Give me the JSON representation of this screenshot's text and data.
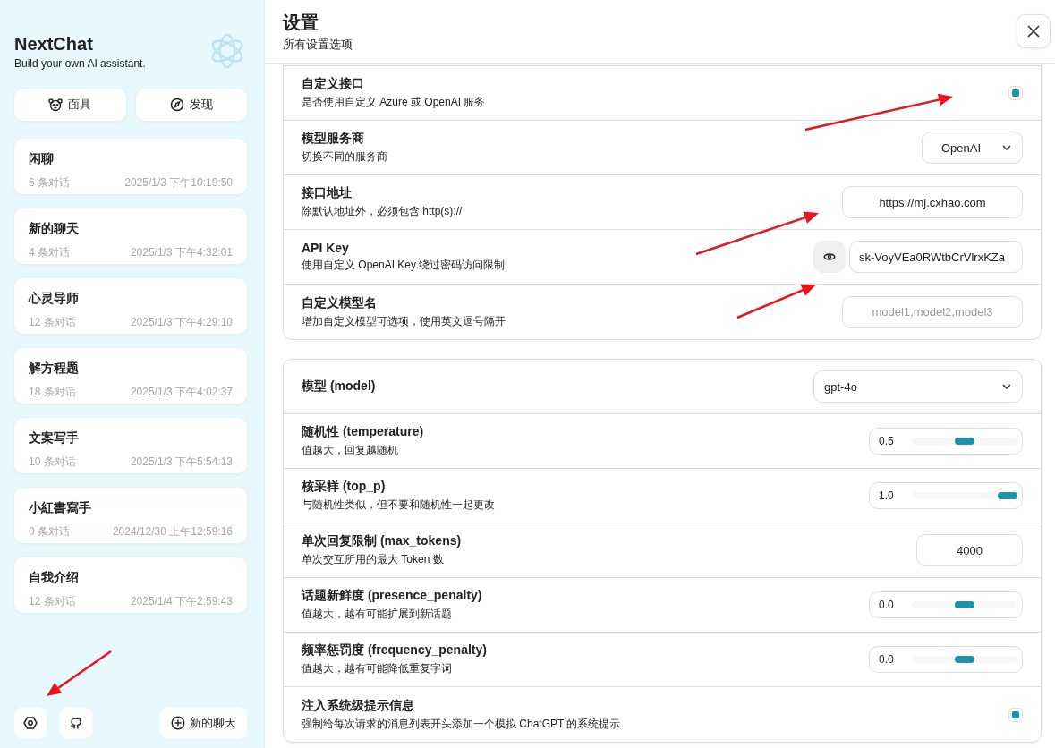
{
  "sidebar": {
    "title": "NextChat",
    "subtitle": "Build your own AI assistant.",
    "top_buttons": [
      {
        "label": "面具",
        "kind": "mask"
      },
      {
        "label": "发现",
        "kind": "discover"
      }
    ],
    "chats": [
      {
        "title": "闲聊",
        "count": "6 条对话",
        "time": "2025/1/3 下午10:19:50"
      },
      {
        "title": "新的聊天",
        "count": "4 条对话",
        "time": "2025/1/3 下午4:32:01"
      },
      {
        "title": "心灵导师",
        "count": "12 条对话",
        "time": "2025/1/3 下午4:29:10"
      },
      {
        "title": "解方程题",
        "count": "18 条对话",
        "time": "2025/1/3 下午4:02:37"
      },
      {
        "title": "文案写手",
        "count": "10 条对话",
        "time": "2025/1/3 下午5:54:13"
      },
      {
        "title": "小紅書寫手",
        "count": "0 条对话",
        "time": "2024/12/30 上午12:59:16"
      },
      {
        "title": "自我介绍",
        "count": "12 条对话",
        "time": "2025/1/4 下午2:59:43"
      }
    ],
    "new_chat_button": "新的聊天"
  },
  "header": {
    "title": "设置",
    "subtitle": "所有设置选项"
  },
  "cards": [
    {
      "rows": [
        {
          "kind": "checkbox",
          "title": "自定义接口",
          "desc": "是否使用自定义 Azure 或 OpenAI 服务",
          "checked": true
        },
        {
          "kind": "select",
          "title": "模型服务商",
          "desc": "切换不同的服务商",
          "value": "OpenAI"
        },
        {
          "kind": "input",
          "title": "接口地址",
          "desc": "除默认地址外，必须包含 http(s)://",
          "value": "https://mj.cxhao.com"
        },
        {
          "kind": "password",
          "title": "API Key",
          "desc": "使用自定义 OpenAI Key 绕过密码访问限制",
          "value": "sk-VoyVEa0RWtbCrVlrxKZa"
        },
        {
          "kind": "input",
          "title": "自定义模型名",
          "desc": "增加自定义模型可选项，使用英文逗号隔开",
          "placeholder": "model1,model2,model3"
        }
      ]
    },
    {
      "rows": [
        {
          "kind": "wideselect",
          "title": "模型 (model)",
          "value": "gpt-4o"
        },
        {
          "kind": "slider",
          "title": "随机性 (temperature)",
          "desc": "值越大，回复越随机",
          "value": "0.5",
          "level": 0.5
        },
        {
          "kind": "slider",
          "title": "核采样 (top_p)",
          "desc": "与随机性类似，但不要和随机性一起更改",
          "value": "1.0",
          "level": 1
        },
        {
          "kind": "number",
          "title": "单次回复限制 (max_tokens)",
          "desc": "单次交互所用的最大 Token 数",
          "value": "4000"
        },
        {
          "kind": "slider",
          "title": "话题新鲜度 (presence_penalty)",
          "desc": "值越大，越有可能扩展到新话题",
          "value": "0.0",
          "level": 0.5
        },
        {
          "kind": "slider",
          "title": "频率惩罚度 (frequency_penalty)",
          "desc": "值越大，越有可能降低重复字词",
          "value": "0.0",
          "level": 0.5
        },
        {
          "kind": "checkbox",
          "title": "注入系统级提示信息",
          "desc": "强制给每次请求的消息列表开头添加一个模拟 ChatGPT 的系统提示",
          "checked": true
        }
      ]
    }
  ]
}
